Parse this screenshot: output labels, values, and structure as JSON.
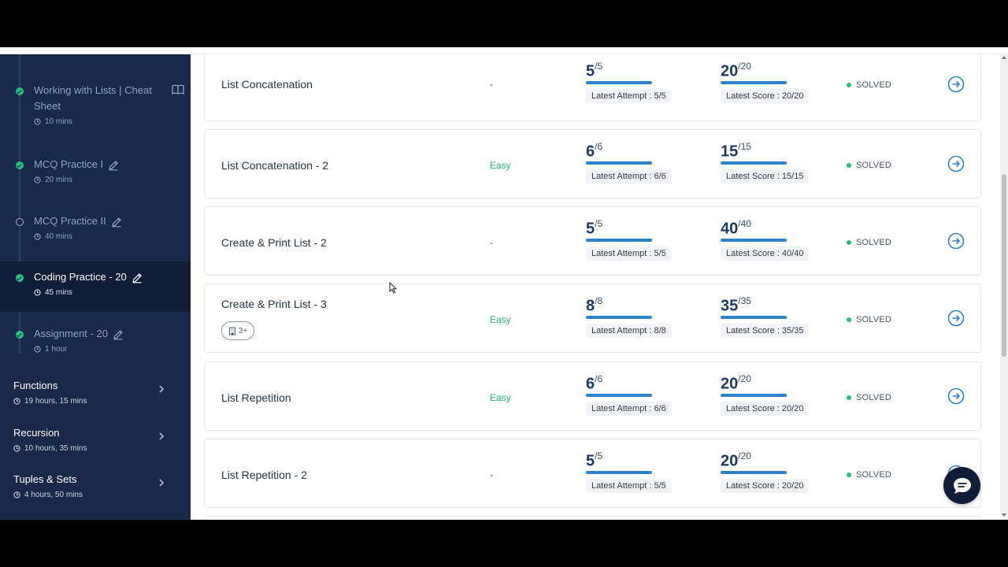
{
  "sidebar": {
    "steps": [
      {
        "title_line1": "Working with Lists | Cheat",
        "title_line2": "Sheet",
        "duration": "10 mins",
        "status": "done",
        "icon": "book-icon"
      },
      {
        "title": "MCQ Practice I",
        "duration": "20 mins",
        "status": "done",
        "icon": "pencil-icon"
      },
      {
        "title": "MCQ Practice II",
        "duration": "40 mins",
        "status": "open",
        "icon": "pencil-icon"
      },
      {
        "title": "Coding Practice - 20",
        "duration": "45 mins",
        "status": "done",
        "active": true,
        "icon": "pencil-icon"
      },
      {
        "title": "Assignment - 20",
        "duration": "1 hour",
        "status": "done",
        "icon": "pencil-icon"
      }
    ],
    "modules": [
      {
        "title": "Functions",
        "duration": "19 hours, 15 mins"
      },
      {
        "title": "Recursion",
        "duration": "10 hours, 35 mins"
      },
      {
        "title": "Tuples & Sets",
        "duration": "4 hours, 50 mins"
      }
    ]
  },
  "problems": [
    {
      "title": "List Concatenation",
      "difficulty": "-",
      "attempt_score": "5",
      "attempt_total": "/5",
      "attempt_label": "Latest Attempt : 5/5",
      "score": "20",
      "score_total": "/20",
      "score_label": "Latest Score : 20/20",
      "status": "SOLVED"
    },
    {
      "title": "List Concatenation - 2",
      "difficulty": "Easy",
      "attempt_score": "6",
      "attempt_total": "/6",
      "attempt_label": "Latest Attempt : 6/6",
      "score": "15",
      "score_total": "/15",
      "score_label": "Latest Score : 15/15",
      "status": "SOLVED"
    },
    {
      "title": "Create & Print List - 2",
      "difficulty": "-",
      "attempt_score": "5",
      "attempt_total": "/5",
      "attempt_label": "Latest Attempt : 5/5",
      "score": "40",
      "score_total": "/40",
      "score_label": "Latest Score : 40/40",
      "status": "SOLVED"
    },
    {
      "title": "Create & Print List - 3",
      "difficulty": "Easy",
      "badge": "3+",
      "attempt_score": "8",
      "attempt_total": "/8",
      "attempt_label": "Latest Attempt : 8/8",
      "score": "35",
      "score_total": "/35",
      "score_label": "Latest Score : 35/35",
      "status": "SOLVED"
    },
    {
      "title": "List Repetition",
      "difficulty": "Easy",
      "attempt_score": "6",
      "attempt_total": "/6",
      "attempt_label": "Latest Attempt : 6/6",
      "score": "20",
      "score_total": "/20",
      "score_label": "Latest Score : 20/20",
      "status": "SOLVED"
    },
    {
      "title": "List Repetition - 2",
      "difficulty": "-",
      "attempt_score": "5",
      "attempt_total": "/5",
      "attempt_label": "Latest Attempt : 5/5",
      "score": "20",
      "score_total": "/20",
      "score_label": "Latest Score : 20/20",
      "status": "SOLVED"
    }
  ],
  "colors": {
    "sidebar_bg": "#18294a",
    "active_bg": "#0f1d38",
    "success": "#25c17a",
    "progress": "#2e83c8",
    "accent_link": "#2e83c8"
  }
}
